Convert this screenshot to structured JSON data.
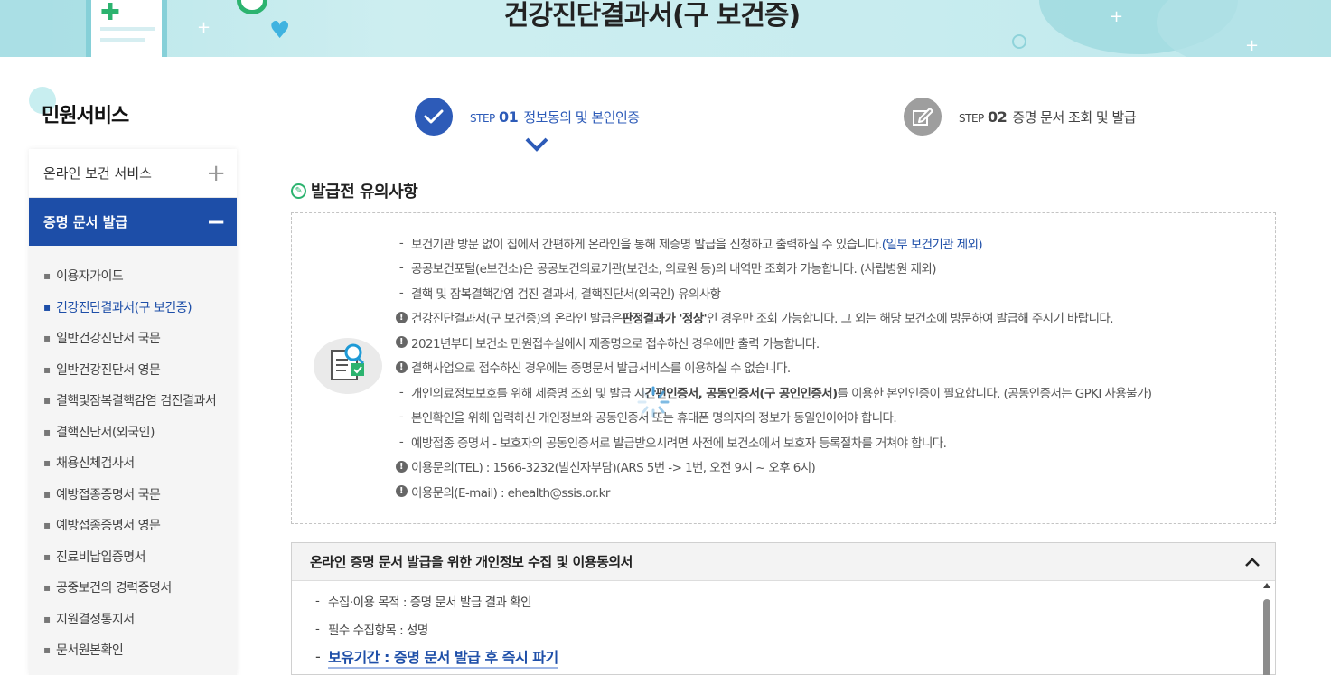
{
  "banner": {
    "title": "건강진단결과서(구 보건증)"
  },
  "sidebar": {
    "title": "민원서비스",
    "top_item": "온라인 보건 서비스",
    "active_item": "증명 문서 발급",
    "items": [
      "이용자가이드",
      "건강진단결과서(구 보건증)",
      "일반건강진단서 국문",
      "일반건강진단서 영문",
      "결핵및잠복결핵감염 검진결과서",
      "결핵진단서(외국인)",
      "채용신체검사서",
      "예방접종증명서 국문",
      "예방접종증명서 영문",
      "진료비납입증명서",
      "공중보건의 경력증명서",
      "지원결정통지서",
      "문서원본확인"
    ]
  },
  "steps": [
    {
      "step": "STEP",
      "num": "01",
      "label": "정보동의 및 본인인증"
    },
    {
      "step": "STEP",
      "num": "02",
      "label": "증명 문서 조회 및 발급"
    }
  ],
  "notice": {
    "title": "발급전 유의사항",
    "lines": {
      "l1a": "보건기관 방문 없이 집에서 간편하게 온라인을 통해 제증명 발급을 신청하고 출력하실 수 있습니다.",
      "l1b": "(일부 보건기관 제외)",
      "l2": "공공보건포털(e보건소)은 공공보건의료기관(보건소, 의료원 등)의 내역만 조회가 가능합니다. (사립병원 제외)",
      "l3": "결핵 및 잠복결핵감염 검진 결과서, 결핵진단서(외국인) 유의사항",
      "l4a": "건강진단결과서(구 보건증)의 온라인 발급은 ",
      "l4b": "판정결과가 '정상'",
      "l4c": "인 경우만 조회 가능합니다. 그 외는 해당 보건소에 방문하여 발급해 주시기 바랍니다.",
      "l5": "2021년부터 보건소 민원접수실에서 제증명으로 접수하신 경우에만 출력 가능합니다.",
      "l6": "결핵사업으로 접수하신 경우에는 증명문서 발급서비스를 이용하실 수 없습니다.",
      "l7a": "개인의료정보보호를 위해 제증명 조회 및 발급 시 ",
      "l7b": "간편인증서, 공동인증서(구 공인인증서)",
      "l7c": "를 이용한 본인인증이 필요합니다. (공동인증서는 GPKI 사용불가)",
      "l8": "본인확인을 위해 입력하신 개인정보와 공동인증서 또는 휴대폰 명의자의 정보가 동일인이어야 합니다.",
      "l9": "예방접종 증명서 - 보호자의 공동인증서로 발급받으시려면 사전에 보건소에서 보호자 등록절차를 거쳐야 합니다.",
      "l10": "이용문의(TEL) : 1566-3232(발신자부담)(ARS 5번 -> 1번, 오전 9시 ~ 오후 6시)",
      "l11": "이용문의(E-mail) : ehealth@ssis.or.kr"
    }
  },
  "consent": {
    "title": "온라인 증명 문서 발급을 위한 개인정보 수집 및 이용동의서",
    "rows": [
      "수집·이용 목적 : 증명 문서 발급 결과 확인",
      "필수 수집항목 : 성명",
      "보유기간 : 증명 문서 발급 후 즉시 파기"
    ]
  },
  "icons": {
    "check": "check-icon",
    "edit": "edit-icon",
    "plus": "plus-icon",
    "minus": "minus-icon",
    "chevron_up": "chevron-up-icon",
    "search_doc": "document-search-icon"
  },
  "colors": {
    "primary": "#1d4ea8",
    "accent_green": "#2cb36f",
    "banner_bg": "#c7ecef"
  }
}
